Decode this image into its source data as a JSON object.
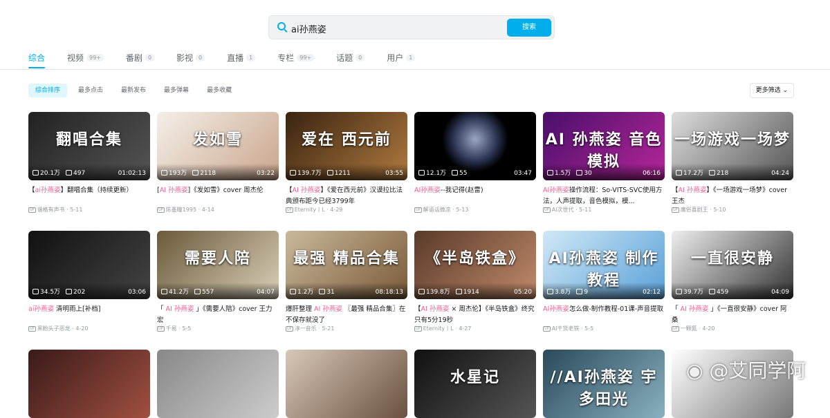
{
  "search": {
    "query": "ai孙燕姿",
    "button": "搜索"
  },
  "tabs": [
    {
      "label": "综合",
      "count": ""
    },
    {
      "label": "视频",
      "count": "99+"
    },
    {
      "label": "番剧",
      "count": "0"
    },
    {
      "label": "影视",
      "count": "0"
    },
    {
      "label": "直播",
      "count": "1"
    },
    {
      "label": "专栏",
      "count": "99+"
    },
    {
      "label": "话题",
      "count": "0"
    },
    {
      "label": "用户",
      "count": "1"
    }
  ],
  "sorts": [
    "综合排序",
    "最多点击",
    "最新发布",
    "最多弹幕",
    "最多收藏"
  ],
  "more_filters": "更多筛选",
  "up_badge": "UP",
  "colors": {
    "accent": "#00aeec",
    "highlight": "#f25d8e"
  },
  "videos": [
    {
      "cap": "翻唱合集",
      "bg": "linear-gradient(135deg,#222,#555)",
      "views": "20.1万",
      "danmaku": "497",
      "duration": "01:02:13",
      "pre": "【",
      "hl": "ai孙燕姿",
      "post": "】翻唱合集（持续更新）",
      "up": "谐格有声书",
      "date": "5-11"
    },
    {
      "cap": "发如雪",
      "bg": "linear-gradient(135deg,#f4efe8,#c9a58c)",
      "views": "193万",
      "danmaku": "2118",
      "duration": "03:22",
      "pre": "[",
      "hl": "AI 孙燕姿",
      "post": "]《发如雪》cover 周杰伦",
      "up": "陈墨瞳1995",
      "date": "4-14"
    },
    {
      "cap": "爱在 西元前",
      "bg": "linear-gradient(135deg,#3a2410,#b07a40)",
      "views": "139.7万",
      "danmaku": "1211",
      "duration": "03:55",
      "pre": "【",
      "hl": "AI 孙燕姿",
      "post": "】《爱在西元前》汉谟拉比法典颁布距今已经3799年",
      "up": "Eternity丨L",
      "date": "4-29"
    },
    {
      "cap": "",
      "bg": "radial-gradient(circle at 50% 40%,#9aa6c4 0,#2a3350 30%,#000 45%)",
      "views": "12.1万",
      "danmaku": "55",
      "duration": "03:47",
      "pre": "",
      "hl": "AI孙燕姿",
      "post": "--我记得(赵雷)",
      "up": "解语话微凉",
      "date": "5-13"
    },
    {
      "cap": "AI 孙燕姿 音色模拟",
      "bg": "linear-gradient(135deg,#4a0f6b,#b6269b)",
      "views": "1.5万",
      "danmaku": "30",
      "duration": "06:16",
      "pre": "",
      "hl": "AI孙燕姿",
      "post": "操作流程：So-VITS-SVC使用方法，人声提取，音色模拟，模...",
      "up": "AI次世代",
      "date": "5-11"
    },
    {
      "cap": "一场游戏一场梦",
      "bg": "linear-gradient(135deg,#ddd,#555)",
      "views": "17.2万",
      "danmaku": "218",
      "duration": "04:24",
      "pre": "【",
      "hl": "AI 孙燕姿",
      "post": "】《一场游戏一场梦》cover 王杰",
      "up": "庸俗喜剧王",
      "date": "5-10"
    },
    {
      "cap": "",
      "bg": "linear-gradient(135deg,#111,#444)",
      "views": "34.5万",
      "danmaku": "202",
      "duration": "03:06",
      "pre": "",
      "hl": "ai孙燕姿",
      "post": " 清明雨上[补档]",
      "up": "黑粉头子恶龙",
      "date": "4-20"
    },
    {
      "cap": "需要人陪",
      "bg": "linear-gradient(135deg,#6b5a3a,#d9cfb8)",
      "views": "41.2万",
      "danmaku": "557",
      "duration": "04:07",
      "pre": "「 ",
      "hl": "AI 孙燕姿",
      "post": " 」《需要人陪》cover 王力宏",
      "up": "千易",
      "date": "5-5"
    },
    {
      "cap": "最强 精品合集",
      "bg": "linear-gradient(135deg,#c9b89a,#7a5a3a)",
      "views": "1.2万",
      "danmaku": "31",
      "duration": "08:18:13",
      "pre": "爆肝整理 ",
      "hl": "AI 孙燕姿",
      "post": " 〖最强 精品合集〗在不保存就没了",
      "up": "淳一音乐",
      "date": "5-21"
    },
    {
      "cap": "《半岛铁盒》",
      "bg": "linear-gradient(135deg,#5a3a2a,#c08a6a)",
      "views": "139.8万",
      "danmaku": "1914",
      "duration": "05:20",
      "pre": "【",
      "hl": "AI 孙燕姿",
      "post": " × 周杰伦】《半岛铁盒》终究只有5分19秒",
      "up": "Eternity丨L",
      "date": "4-27"
    },
    {
      "cap": "AI孙燕姿 制作教程",
      "bg": "linear-gradient(135deg,#cfe8f6,#5aa0d8)",
      "views": "3.8万",
      "danmaku": "9",
      "duration": "02:12",
      "pre": "",
      "hl": "AI孙燕姿",
      "post": "怎么做-制作教程-01课-声音提取",
      "up": "AI干货老铁",
      "date": "5-5"
    },
    {
      "cap": "一直很安静",
      "bg": "linear-gradient(135deg,#eee,#333)",
      "views": "39.7万",
      "danmaku": "459",
      "duration": "04:09",
      "pre": "「 ",
      "hl": "AI 孙燕姿",
      "post": " 」《一直很安静》cover 阿桑",
      "up": "一颗氮",
      "date": "4-20"
    },
    {
      "cap": "",
      "bg": "linear-gradient(135deg,#3a1a1a,#a05040)",
      "views": "",
      "danmaku": "",
      "duration": "",
      "pre": "",
      "hl": "",
      "post": "",
      "up": "",
      "date": ""
    },
    {
      "cap": "",
      "bg": "linear-gradient(135deg,#888,#ccc)",
      "views": "",
      "danmaku": "",
      "duration": "",
      "pre": "",
      "hl": "",
      "post": "",
      "up": "",
      "date": ""
    },
    {
      "cap": "",
      "bg": "linear-gradient(135deg,#d8c8b8,#6a5040)",
      "views": "",
      "danmaku": "",
      "duration": "",
      "pre": "",
      "hl": "",
      "post": "",
      "up": "",
      "date": ""
    },
    {
      "cap": "水星记",
      "bg": "linear-gradient(135deg,#111,#555)",
      "views": "",
      "danmaku": "",
      "duration": "",
      "pre": "",
      "hl": "",
      "post": "",
      "up": "",
      "date": ""
    },
    {
      "cap": "//AI孙燕姿 宇多田光",
      "bg": "linear-gradient(135deg,#2a4a5a,#8ab0c0)",
      "views": "",
      "danmaku": "",
      "duration": "",
      "pre": "",
      "hl": "",
      "post": "",
      "up": "",
      "date": ""
    },
    {
      "cap": "",
      "bg": "linear-gradient(135deg,#fff,#777)",
      "views": "",
      "danmaku": "",
      "duration": "",
      "pre": "",
      "hl": "",
      "post": "",
      "up": "",
      "date": ""
    }
  ],
  "watermark": "@艾同学阿"
}
